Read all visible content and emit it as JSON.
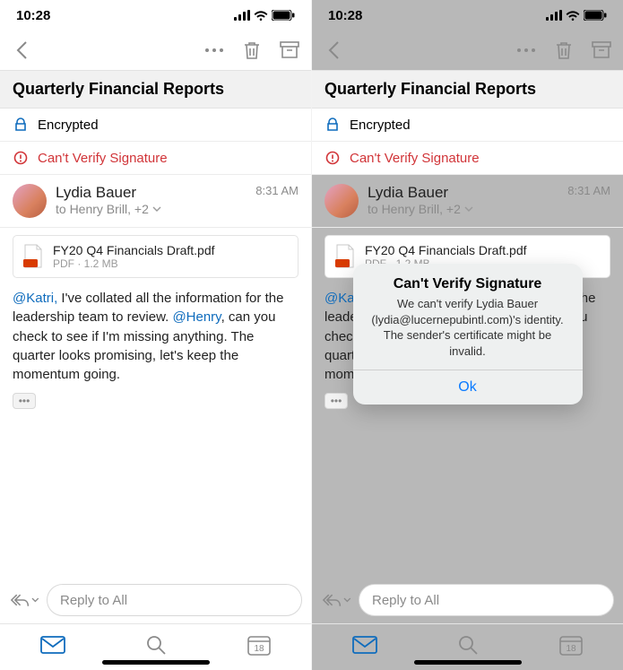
{
  "status": {
    "time": "10:28"
  },
  "subject": "Quarterly Financial Reports",
  "flags": {
    "encrypted": "Encrypted",
    "signature_warning": "Can't Verify Signature"
  },
  "sender": {
    "name": "Lydia Bauer",
    "to_line": "to Henry Brill, +2",
    "time": "8:31 AM"
  },
  "attachment": {
    "name": "FY20 Q4 Financials Draft.pdf",
    "meta": "PDF · 1.2 MB"
  },
  "body": {
    "mention1": "@Katri,",
    "mention2": "@Henry",
    "text_part1": " I've collated all the information for the leadership team to review. ",
    "text_part2": ", can you check to see if I'm missing anything. The quarter looks promising, let's keep the momentum going."
  },
  "reply": {
    "placeholder": "Reply to All"
  },
  "calendar_day": "18",
  "dialog": {
    "title": "Can't Verify Signature",
    "line1": "We can't verify Lydia Bauer",
    "line2": "(lydia@lucernepubintl.com)'s identity.",
    "line3": "The sender's certificate might be",
    "line4": "invalid.",
    "ok": "Ok"
  }
}
